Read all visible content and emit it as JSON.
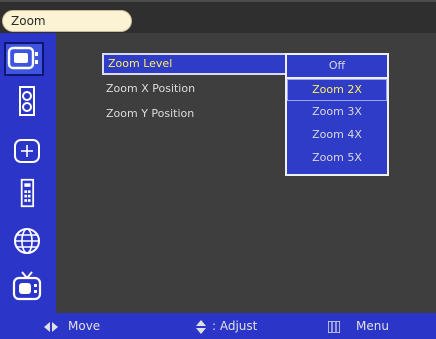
{
  "header": {
    "title": "Zoom"
  },
  "sidebar": {
    "icons": [
      "display-icon",
      "speaker-icon",
      "picture-adjust-icon",
      "remote-control-icon",
      "globe-icon",
      "tv-icon"
    ],
    "active_index": 0
  },
  "menu": {
    "items": [
      {
        "label": "Zoom Level",
        "selected": true
      },
      {
        "label": "Zoom X Position",
        "selected": false
      },
      {
        "label": "Zoom Y Position",
        "selected": false
      }
    ]
  },
  "submenu": {
    "options": [
      "Off",
      "Zoom 2X",
      "Zoom 3X",
      "Zoom 4X",
      "Zoom 5X"
    ],
    "highlighted": "Zoom 2X"
  },
  "footer": {
    "move_label": "Move",
    "adjust_label": ": Adjust",
    "menu_label": "Menu"
  },
  "colors": {
    "blue_panel": "#2b36c8",
    "highlight_text": "#ffef57",
    "background": "#3e3e3e"
  }
}
